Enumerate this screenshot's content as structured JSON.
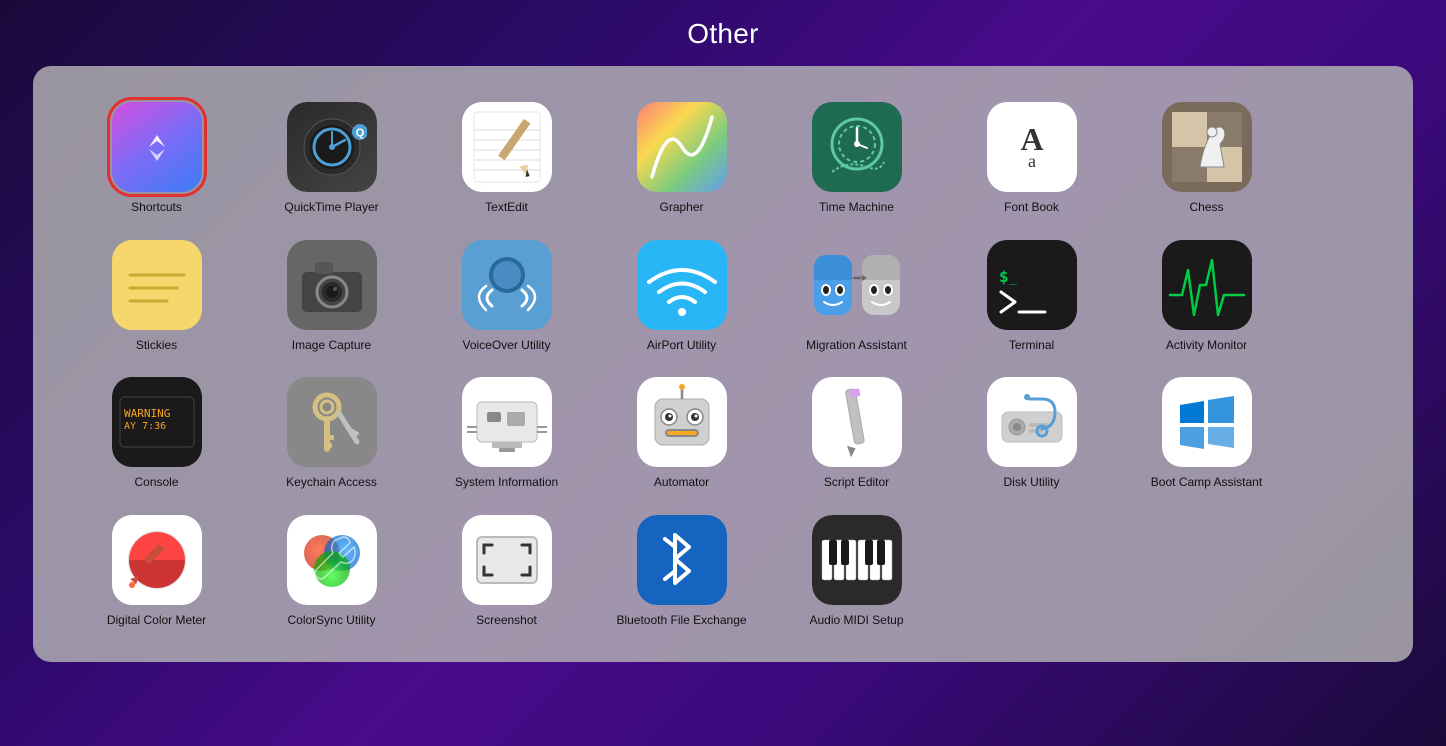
{
  "page": {
    "title": "Other"
  },
  "apps": [
    [
      {
        "id": "shortcuts",
        "label": "Shortcuts",
        "selected": true
      },
      {
        "id": "quicktime",
        "label": "QuickTime Player",
        "selected": false
      },
      {
        "id": "textedit",
        "label": "TextEdit",
        "selected": false
      },
      {
        "id": "grapher",
        "label": "Grapher",
        "selected": false
      },
      {
        "id": "timemachine",
        "label": "Time Machine",
        "selected": false
      },
      {
        "id": "fontbook",
        "label": "Font Book",
        "selected": false
      },
      {
        "id": "chess",
        "label": "Chess",
        "selected": false
      }
    ],
    [
      {
        "id": "stickies",
        "label": "Stickies",
        "selected": false
      },
      {
        "id": "imagecapture",
        "label": "Image Capture",
        "selected": false
      },
      {
        "id": "voiceover",
        "label": "VoiceOver Utility",
        "selected": false
      },
      {
        "id": "airport",
        "label": "AirPort Utility",
        "selected": false
      },
      {
        "id": "migration",
        "label": "Migration Assistant",
        "selected": false
      },
      {
        "id": "terminal",
        "label": "Terminal",
        "selected": false
      },
      {
        "id": "activitymonitor",
        "label": "Activity Monitor",
        "selected": false
      }
    ],
    [
      {
        "id": "console",
        "label": "Console",
        "selected": false
      },
      {
        "id": "keychain",
        "label": "Keychain Access",
        "selected": false
      },
      {
        "id": "sysinfo",
        "label": "System Information",
        "selected": false
      },
      {
        "id": "automator",
        "label": "Automator",
        "selected": false
      },
      {
        "id": "scripteditor",
        "label": "Script Editor",
        "selected": false
      },
      {
        "id": "diskutility",
        "label": "Disk Utility",
        "selected": false
      },
      {
        "id": "bootcamp",
        "label": "Boot Camp Assistant",
        "selected": false
      }
    ],
    [
      {
        "id": "colorimeter",
        "label": "Digital Color Meter",
        "selected": false
      },
      {
        "id": "colorsync",
        "label": "ColorSync Utility",
        "selected": false
      },
      {
        "id": "screenshot",
        "label": "Screenshot",
        "selected": false
      },
      {
        "id": "bluetooth",
        "label": "Bluetooth File Exchange",
        "selected": false
      },
      {
        "id": "audiomidi",
        "label": "Audio MIDI Setup",
        "selected": false
      }
    ]
  ]
}
